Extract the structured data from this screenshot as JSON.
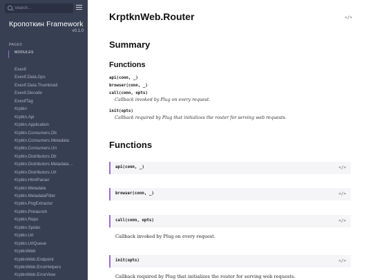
{
  "sidebar": {
    "search_placeholder": "Search...",
    "project_name": "Кропоткин Framework",
    "project_version": "v0.1.0",
    "tabs": [
      {
        "label": "PAGES"
      },
      {
        "label": "MODULES"
      }
    ],
    "modules": [
      "Exexif",
      "Exexif.Data.Gps",
      "Exexif.Data.Thumbnail",
      "Exexif.Decode",
      "ExexifTag",
      "Krptkn",
      "Krptkn.Api",
      "Krptkn.Application",
      "Krptkn.Consumers.Db",
      "Krptkn.Consumers.Metadata",
      "Krptkn.Consumers.Url",
      "Krptkn.Distributors.Db",
      "Krptkn.Distributors.Metadata…",
      "Krptkn.Distributors.Url",
      "Krptkn.HtmlParser",
      "Krptkn.Metadata",
      "Krptkn.MetadataFilter",
      "Krptkn.PngExtractor",
      "Krptkn.Prelaunch",
      "Krptkn.Repo",
      "Krptkn.Spider",
      "Krptkn.Url",
      "Krptkn.UrlQueue",
      "KrptknWeb",
      "KrptknWeb.Endpoint",
      "KrptknWeb.ErrorHelpers",
      "KrptknWeb.ErrorView"
    ]
  },
  "main": {
    "title": "KrptknWeb.Router",
    "code_icon": "</>",
    "summary_heading": "Summary",
    "functions_subheading": "Functions",
    "summary_items": [
      {
        "sig": "api(conn, _)",
        "desc": ""
      },
      {
        "sig": "browser(conn, _)",
        "desc": ""
      },
      {
        "sig": "call(conn, opts)",
        "desc": "Callback invoked by Plug on every request."
      },
      {
        "sig": "init(opts)",
        "desc": "Callback required by Plug that initializes the router for serving web requests."
      }
    ],
    "functions_heading": "Functions",
    "details": [
      {
        "sig": "api(conn, _)",
        "doc": ""
      },
      {
        "sig": "browser(conn, _)",
        "doc": ""
      },
      {
        "sig": "call(conn, opts)",
        "doc": "Callback invoked by Plug on every request."
      },
      {
        "sig": "init(opts)",
        "doc": "Callback required by Plug that initializes the router for serving web requests."
      }
    ]
  },
  "colors": {
    "sidebar_bg": "#373f52",
    "accent": "#9b6cd6",
    "header_bg": "#f5f5f7"
  }
}
